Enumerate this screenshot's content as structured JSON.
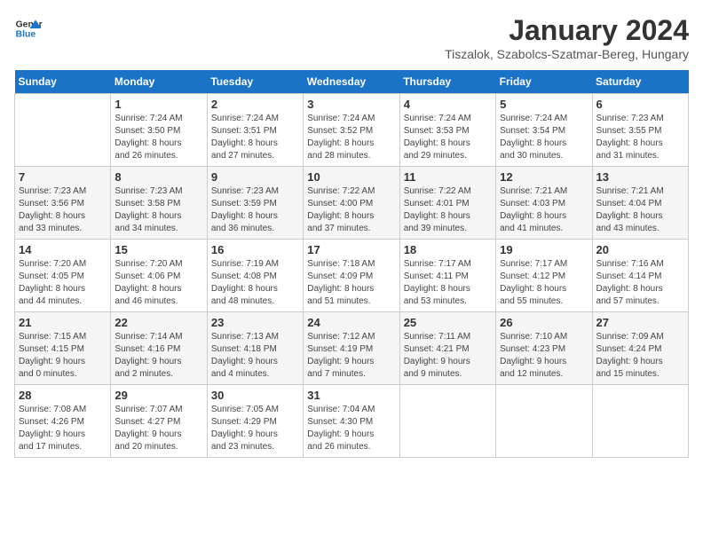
{
  "logo": {
    "line1": "General",
    "line2": "Blue"
  },
  "title": "January 2024",
  "subtitle": "Tiszalok, Szabolcs-Szatmar-Bereg, Hungary",
  "days_header": [
    "Sunday",
    "Monday",
    "Tuesday",
    "Wednesday",
    "Thursday",
    "Friday",
    "Saturday"
  ],
  "weeks": [
    [
      {
        "day": "",
        "info": ""
      },
      {
        "day": "1",
        "info": "Sunrise: 7:24 AM\nSunset: 3:50 PM\nDaylight: 8 hours\nand 26 minutes."
      },
      {
        "day": "2",
        "info": "Sunrise: 7:24 AM\nSunset: 3:51 PM\nDaylight: 8 hours\nand 27 minutes."
      },
      {
        "day": "3",
        "info": "Sunrise: 7:24 AM\nSunset: 3:52 PM\nDaylight: 8 hours\nand 28 minutes."
      },
      {
        "day": "4",
        "info": "Sunrise: 7:24 AM\nSunset: 3:53 PM\nDaylight: 8 hours\nand 29 minutes."
      },
      {
        "day": "5",
        "info": "Sunrise: 7:24 AM\nSunset: 3:54 PM\nDaylight: 8 hours\nand 30 minutes."
      },
      {
        "day": "6",
        "info": "Sunrise: 7:23 AM\nSunset: 3:55 PM\nDaylight: 8 hours\nand 31 minutes."
      }
    ],
    [
      {
        "day": "7",
        "info": "Sunrise: 7:23 AM\nSunset: 3:56 PM\nDaylight: 8 hours\nand 33 minutes."
      },
      {
        "day": "8",
        "info": "Sunrise: 7:23 AM\nSunset: 3:58 PM\nDaylight: 8 hours\nand 34 minutes."
      },
      {
        "day": "9",
        "info": "Sunrise: 7:23 AM\nSunset: 3:59 PM\nDaylight: 8 hours\nand 36 minutes."
      },
      {
        "day": "10",
        "info": "Sunrise: 7:22 AM\nSunset: 4:00 PM\nDaylight: 8 hours\nand 37 minutes."
      },
      {
        "day": "11",
        "info": "Sunrise: 7:22 AM\nSunset: 4:01 PM\nDaylight: 8 hours\nand 39 minutes."
      },
      {
        "day": "12",
        "info": "Sunrise: 7:21 AM\nSunset: 4:03 PM\nDaylight: 8 hours\nand 41 minutes."
      },
      {
        "day": "13",
        "info": "Sunrise: 7:21 AM\nSunset: 4:04 PM\nDaylight: 8 hours\nand 43 minutes."
      }
    ],
    [
      {
        "day": "14",
        "info": "Sunrise: 7:20 AM\nSunset: 4:05 PM\nDaylight: 8 hours\nand 44 minutes."
      },
      {
        "day": "15",
        "info": "Sunrise: 7:20 AM\nSunset: 4:06 PM\nDaylight: 8 hours\nand 46 minutes."
      },
      {
        "day": "16",
        "info": "Sunrise: 7:19 AM\nSunset: 4:08 PM\nDaylight: 8 hours\nand 48 minutes."
      },
      {
        "day": "17",
        "info": "Sunrise: 7:18 AM\nSunset: 4:09 PM\nDaylight: 8 hours\nand 51 minutes."
      },
      {
        "day": "18",
        "info": "Sunrise: 7:17 AM\nSunset: 4:11 PM\nDaylight: 8 hours\nand 53 minutes."
      },
      {
        "day": "19",
        "info": "Sunrise: 7:17 AM\nSunset: 4:12 PM\nDaylight: 8 hours\nand 55 minutes."
      },
      {
        "day": "20",
        "info": "Sunrise: 7:16 AM\nSunset: 4:14 PM\nDaylight: 8 hours\nand 57 minutes."
      }
    ],
    [
      {
        "day": "21",
        "info": "Sunrise: 7:15 AM\nSunset: 4:15 PM\nDaylight: 9 hours\nand 0 minutes."
      },
      {
        "day": "22",
        "info": "Sunrise: 7:14 AM\nSunset: 4:16 PM\nDaylight: 9 hours\nand 2 minutes."
      },
      {
        "day": "23",
        "info": "Sunrise: 7:13 AM\nSunset: 4:18 PM\nDaylight: 9 hours\nand 4 minutes."
      },
      {
        "day": "24",
        "info": "Sunrise: 7:12 AM\nSunset: 4:19 PM\nDaylight: 9 hours\nand 7 minutes."
      },
      {
        "day": "25",
        "info": "Sunrise: 7:11 AM\nSunset: 4:21 PM\nDaylight: 9 hours\nand 9 minutes."
      },
      {
        "day": "26",
        "info": "Sunrise: 7:10 AM\nSunset: 4:23 PM\nDaylight: 9 hours\nand 12 minutes."
      },
      {
        "day": "27",
        "info": "Sunrise: 7:09 AM\nSunset: 4:24 PM\nDaylight: 9 hours\nand 15 minutes."
      }
    ],
    [
      {
        "day": "28",
        "info": "Sunrise: 7:08 AM\nSunset: 4:26 PM\nDaylight: 9 hours\nand 17 minutes."
      },
      {
        "day": "29",
        "info": "Sunrise: 7:07 AM\nSunset: 4:27 PM\nDaylight: 9 hours\nand 20 minutes."
      },
      {
        "day": "30",
        "info": "Sunrise: 7:05 AM\nSunset: 4:29 PM\nDaylight: 9 hours\nand 23 minutes."
      },
      {
        "day": "31",
        "info": "Sunrise: 7:04 AM\nSunset: 4:30 PM\nDaylight: 9 hours\nand 26 minutes."
      },
      {
        "day": "",
        "info": ""
      },
      {
        "day": "",
        "info": ""
      },
      {
        "day": "",
        "info": ""
      }
    ]
  ]
}
